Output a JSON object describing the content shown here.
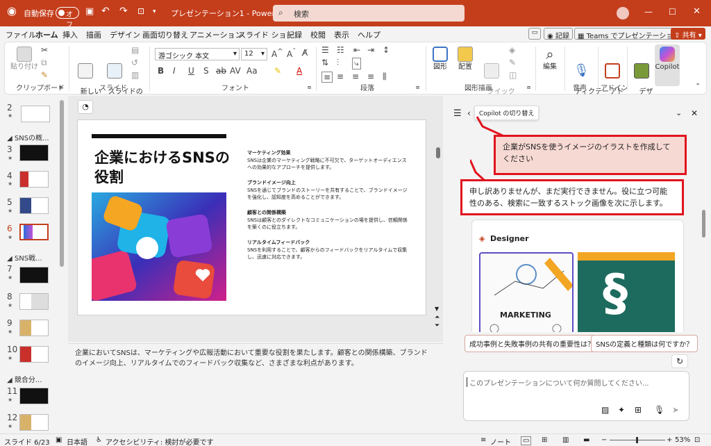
{
  "title": {
    "autosave": "自動保存",
    "toggle": "オフ",
    "doc": "プレゼンテーション1 - Power...",
    "search": "検索"
  },
  "menu": [
    "ファイル",
    "ホーム",
    "挿入",
    "描画",
    "デザイン",
    "画面切り替え",
    "アニメーション",
    "スライド ショー",
    "記録",
    "校閲",
    "表示",
    "ヘルプ"
  ],
  "menu_right": {
    "record": "記録",
    "teams": "Teams でプレゼンテーション",
    "share": "共有"
  },
  "ribbon": {
    "paste": "貼り付け",
    "clipboard": "クリップボード",
    "new_slide": "新しい\nスライド",
    "reuse": "スライドの\n再利用",
    "slides": "スライド",
    "font_name": "游ゴシック 本文",
    "font_size": "12",
    "font": "フォント",
    "paragraph": "段落",
    "shapes": "図形",
    "arrange": "配置",
    "quick_style": "クイック\nスタイル",
    "drawing": "図形描画",
    "edit": "編集",
    "dictate": "ディクテー\nション",
    "voice": "音声",
    "addin": "アド\nイン",
    "addins": "アドイン",
    "designer": "デザ\nイナー",
    "copilot": "Copilot"
  },
  "thumbs": {
    "sections": [
      "SNSの概...",
      "SNS戦...",
      "競合分..."
    ],
    "numbers": [
      "2",
      "3",
      "4",
      "5",
      "6",
      "7",
      "8",
      "9",
      "10",
      "11",
      "12"
    ]
  },
  "slide": {
    "title": "企業におけるSNSの役割",
    "points": [
      {
        "h": "マーケティング効果",
        "b": "SNSは企業のマーケティング戦略に不可欠で、ターゲットオーディエンスへの効果的なアプローチを提供します。"
      },
      {
        "h": "ブランドイメージ向上",
        "b": "SNSを通じてブランドのストーリーを共有することで、ブランドイメージを強化し、認知度を高めることができます。"
      },
      {
        "h": "顧客との関係構築",
        "b": "SNSは顧客とのダイレクトなコミュニケーションの場を提供し、信頼関係を築くのに役立ちます。"
      },
      {
        "h": "リアルタイムフィードバック",
        "b": "SNSを利用することで、顧客からのフィードバックをリアルタイムで収集し、迅速に対応できます。"
      }
    ]
  },
  "notes": "企業においてSNSは、マーケティングや広報活動において重要な役割を果たします。顧客との関係構築、ブランドのイメージ向上、リアルタイムでのフィードバック収集など、さまざまな利点があります。",
  "copilot": {
    "tooltip": "Copilot の切り替え",
    "user_msg": "企業がSNSを使うイメージのイラストを作成してください",
    "reply": "申し訳ありませんが、まだ実行できません。役に立つ可能性のある、検索に一致するストック画像を次に示します。",
    "designer": "Designer",
    "card_text": "MARKETING",
    "suggest1": "成功事例と失敗事例の共有の重要性は？",
    "suggest2": "SNSの定義と種類は何ですか？",
    "placeholder": "このプレゼンテーションについて何か質問してください..."
  },
  "status": {
    "slide": "スライド 6/23",
    "lang": "日本語",
    "access": "アクセシビリティ: 検討が必要です",
    "notes": "ノート",
    "zoom": "53%"
  }
}
